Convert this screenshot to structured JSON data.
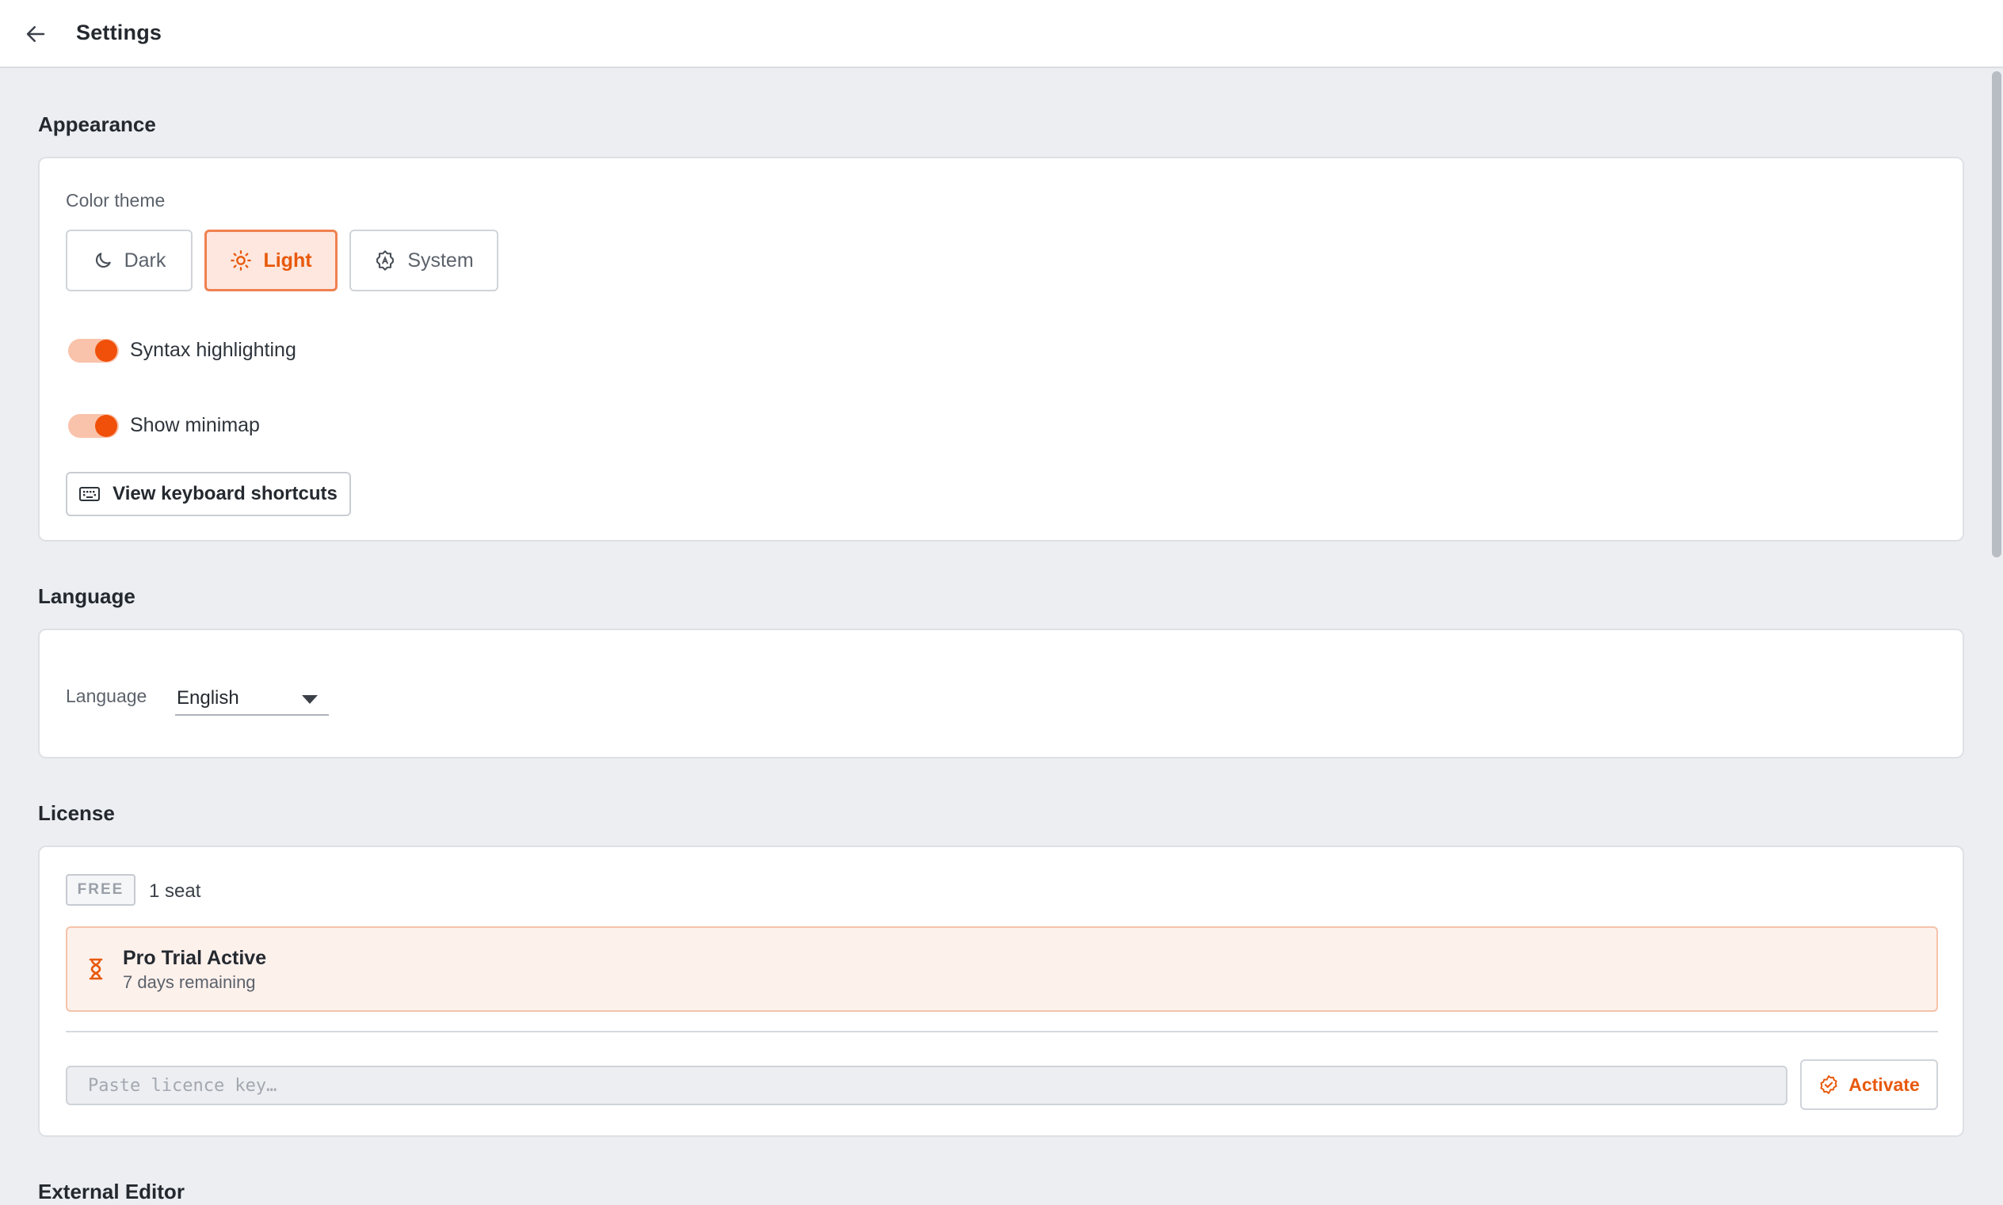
{
  "header": {
    "title": "Settings"
  },
  "appearance": {
    "section_title": "Appearance",
    "color_theme_label": "Color theme",
    "themes": [
      {
        "label": "Dark",
        "icon": "moon-icon",
        "selected": false
      },
      {
        "label": "Light",
        "icon": "sun-icon",
        "selected": true
      },
      {
        "label": "System",
        "icon": "auto-theme-icon",
        "selected": false
      }
    ],
    "toggles": [
      {
        "label": "Syntax highlighting",
        "on": true
      },
      {
        "label": "Show minimap",
        "on": true
      }
    ],
    "shortcuts_button": "View keyboard shortcuts"
  },
  "language": {
    "section_title": "Language",
    "field_label": "Language",
    "selected": "English"
  },
  "license": {
    "section_title": "License",
    "plan_badge": "FREE",
    "seats": "1 seat",
    "trial_title": "Pro Trial Active",
    "trial_remaining": "7 days remaining",
    "key_placeholder": "Paste licence key…",
    "activate_button": "Activate"
  },
  "external_editor": {
    "section_title": "External Editor"
  },
  "colors": {
    "accent": "#e8590c",
    "accent_light": "#fde7de",
    "background": "#eceef2"
  }
}
